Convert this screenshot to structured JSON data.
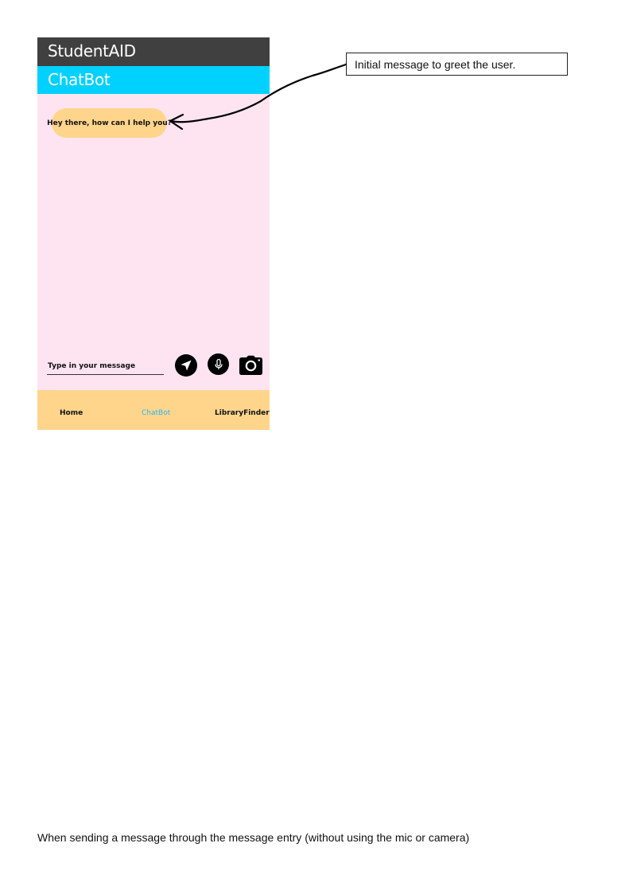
{
  "app": {
    "title": "StudentAID",
    "page_title": "ChatBot",
    "colors": {
      "app_bar": "#404040",
      "page_bar": "#00d1ff",
      "chat_background": "#fde4f0",
      "bubble": "#ffd58c",
      "bottom_nav": "#ffd58c",
      "nav_active": "#29b6f6"
    }
  },
  "chat": {
    "greeting": "Hey there, how can I help you?"
  },
  "composer": {
    "placeholder": "Type in your message",
    "send_icon": "send-icon",
    "mic_icon": "mic-icon",
    "camera_icon": "camera-icon"
  },
  "nav": {
    "home": "Home",
    "chatbot": "ChatBot",
    "library": "LibraryFinder"
  },
  "annotation": {
    "text": "Initial message to greet the user."
  },
  "caption": {
    "text": "When sending a message through the message entry (without using the mic or camera)"
  }
}
